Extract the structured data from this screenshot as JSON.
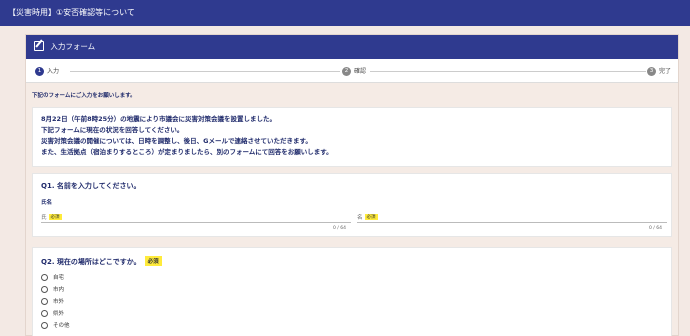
{
  "header": {
    "title": "【災害時用】①安否確認等について"
  },
  "form": {
    "title": "入力フォーム",
    "steps": [
      {
        "num": "1",
        "label": "入力"
      },
      {
        "num": "2",
        "label": "確認"
      },
      {
        "num": "3",
        "label": "完了"
      }
    ],
    "instruction": "下記のフォームにご入力をお願いします。",
    "message": [
      "8月22日（午前8時25分）の地震により市議会に災害対策会議を設置しました。",
      "下記フォームに現在の状況を回答してください。",
      "災害対策会議の開催については、日時を調整し、後日、Gメールで連絡させていただきます。",
      "また、生活拠点（宿泊まりするところ）が定まりましたら、別のフォームにて回答をお願いします。"
    ],
    "q1": {
      "title": "Q1. 名前を入力してください。",
      "sublabel": "氏名",
      "last_name_label": "氏",
      "first_name_label": "名",
      "required": "必須",
      "last_count": "0 / 64",
      "first_count": "0 / 64"
    },
    "q2": {
      "title": "Q2. 現在の場所はどこですか。",
      "required": "必須",
      "options": [
        "自宅",
        "市内",
        "市外",
        "県外",
        "その他"
      ]
    }
  }
}
